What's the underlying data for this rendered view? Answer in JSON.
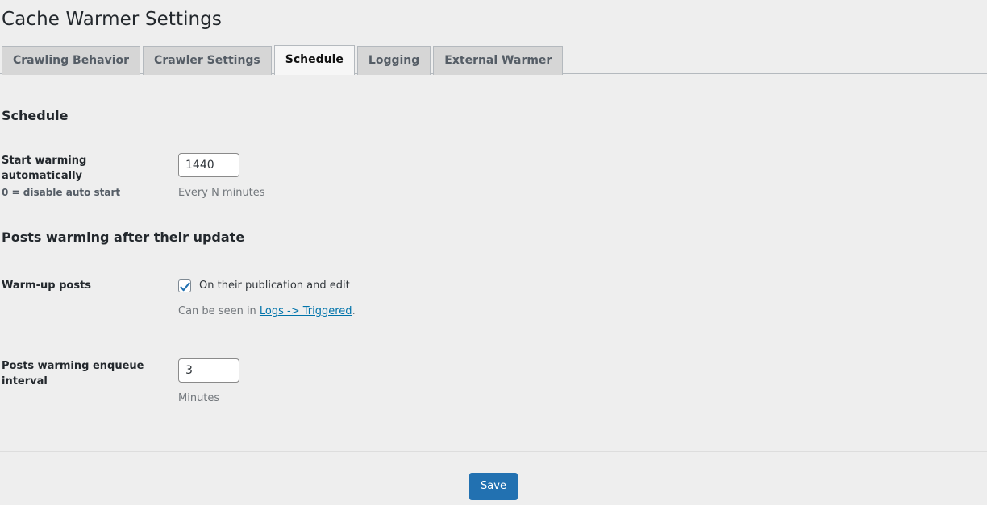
{
  "page": {
    "title": "Cache Warmer Settings"
  },
  "tabs": [
    {
      "label": "Crawling Behavior",
      "active": false
    },
    {
      "label": "Crawler Settings",
      "active": false
    },
    {
      "label": "Schedule",
      "active": true
    },
    {
      "label": "Logging",
      "active": false
    },
    {
      "label": "External Warmer",
      "active": false
    }
  ],
  "sections": {
    "schedule": {
      "heading": "Schedule",
      "auto_start": {
        "label": "Start warming automatically",
        "sub_label": "0 = disable auto start",
        "value": "1440",
        "hint": "Every N minutes"
      }
    },
    "posts_warming": {
      "heading": "Posts warming after their update",
      "warm_up_posts": {
        "label": "Warm-up posts",
        "checkbox_label": "On their publication and edit",
        "checked": true,
        "note_prefix": "Can be seen in ",
        "note_link": "Logs -> Triggered",
        "note_suffix": "."
      },
      "enqueue_interval": {
        "label": "Posts warming enqueue interval",
        "value": "3",
        "hint": "Minutes"
      }
    }
  },
  "footer": {
    "save_label": "Save"
  },
  "colors": {
    "background": "#eeeeee",
    "accent": "#2271b1",
    "link": "#0073aa",
    "tab_inactive": "#d6d6d6",
    "tab_active": "#f6f6f6",
    "border": "#b4b9be",
    "text": "#23282d",
    "muted": "#72777c"
  }
}
